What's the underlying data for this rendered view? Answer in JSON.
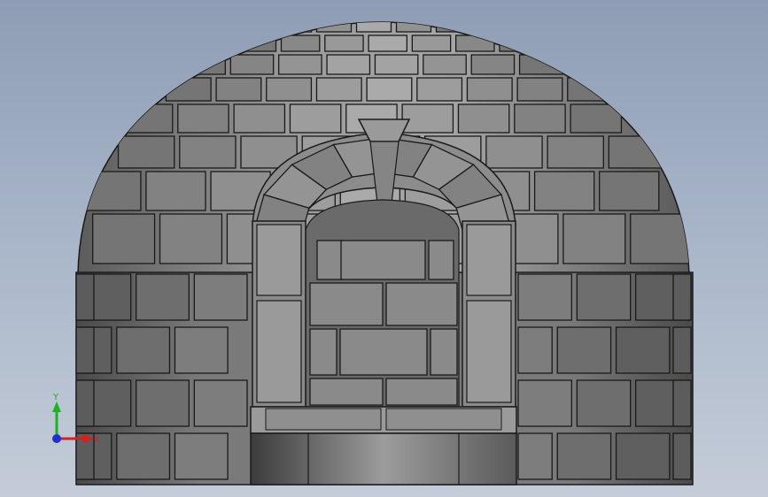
{
  "viewport": {
    "background_top": "#8e9db5",
    "background_bottom": "#c4ccd8"
  },
  "model": {
    "name": "igloo",
    "shell_color": "#8f8f8f",
    "block_edge_color": "#1a1a1a"
  },
  "triad": {
    "x_label": "X",
    "y_label": "Y",
    "x_color": "#d42020",
    "y_color": "#20b020",
    "z_color": "#2030d0"
  }
}
